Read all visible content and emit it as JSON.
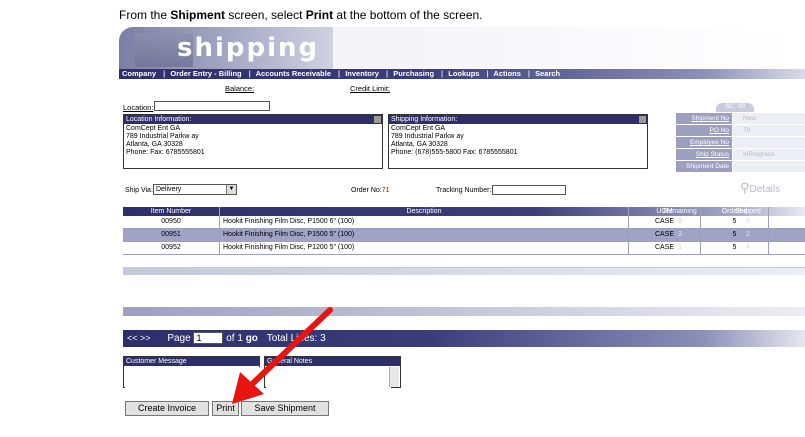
{
  "instruction": {
    "prefix": "From the ",
    "screen": "Shipment",
    "middle": " screen, select ",
    "action": "Print",
    "suffix": " at the bottom of the screen."
  },
  "app": {
    "title": "shipping"
  },
  "nav": [
    "Company",
    "Order Entry - Billing",
    "Accounts Receivable",
    "Inventory",
    "Purchasing",
    "Lookups",
    "Actions",
    "Search"
  ],
  "balance_label": "Balance:",
  "credit_limit_label": "Credit Limit:",
  "location_label": "Location:",
  "location_info": {
    "title": "Location Information:",
    "lines": [
      "ComCept Ent GA",
      "789 Industrial Parkw ay",
      "Atlanta, GA 30328",
      "Phone:    Fax: 6785555801"
    ]
  },
  "shipping_info": {
    "title": "Shipping Information:",
    "lines": [
      "ComCept Ent GA",
      "789 Industrial Parkw ay",
      "Atlanta, GA 30328",
      "Phone: (678)555-5800    Fax: 6785555801"
    ]
  },
  "side_tab": "SC : 00",
  "side_fields": [
    {
      "label": "Shipment No",
      "value": "New"
    },
    {
      "label": "PO No",
      "value": "70"
    },
    {
      "label": "Employee No",
      "value": ""
    },
    {
      "label": "Ship Status",
      "value": "InProgress"
    },
    {
      "label": "Shipment Date",
      "value": ""
    }
  ],
  "ship_via": {
    "label": "Ship Via:",
    "value": "Delivery"
  },
  "order_no": {
    "label": "Order No:",
    "value": "71"
  },
  "tracking": {
    "label": "Tracking Number:",
    "value": ""
  },
  "details_label": "Details",
  "table": {
    "headers": [
      "Item Number",
      "Description",
      "UOM",
      "Ordered",
      "Remaining",
      "Shipped"
    ],
    "rows": [
      [
        "00950",
        "Hookit Finishing Film Disc, P1500 6\" (100)",
        "CASE",
        "5",
        "0",
        "5"
      ],
      [
        "00951",
        "Hookit Finishing Film Disc, P1500 5\" (100)",
        "CASE",
        "5",
        "3",
        "2"
      ],
      [
        "00952",
        "Hookit Finishing Film Disc, P1200 5\" (100)",
        "CASE",
        "5",
        "1",
        "4"
      ]
    ]
  },
  "pager": {
    "nav": "<< >>",
    "page_label": "Page",
    "page_value": "1",
    "of_label": "of 1",
    "go": "go",
    "total_label": "Total Lines: 3"
  },
  "customer_message": {
    "title": "Customer Message"
  },
  "general_notes": {
    "title": "General Notes"
  },
  "buttons": {
    "create_invoice": "Create Invoice",
    "print": "Print",
    "save_shipment": "Save Shipment"
  },
  "colors": {
    "nav_dark": "#2d2f6b",
    "accent_light": "#9c9fc0",
    "arrow": "#e8140f",
    "order_no": "#cc0000"
  }
}
